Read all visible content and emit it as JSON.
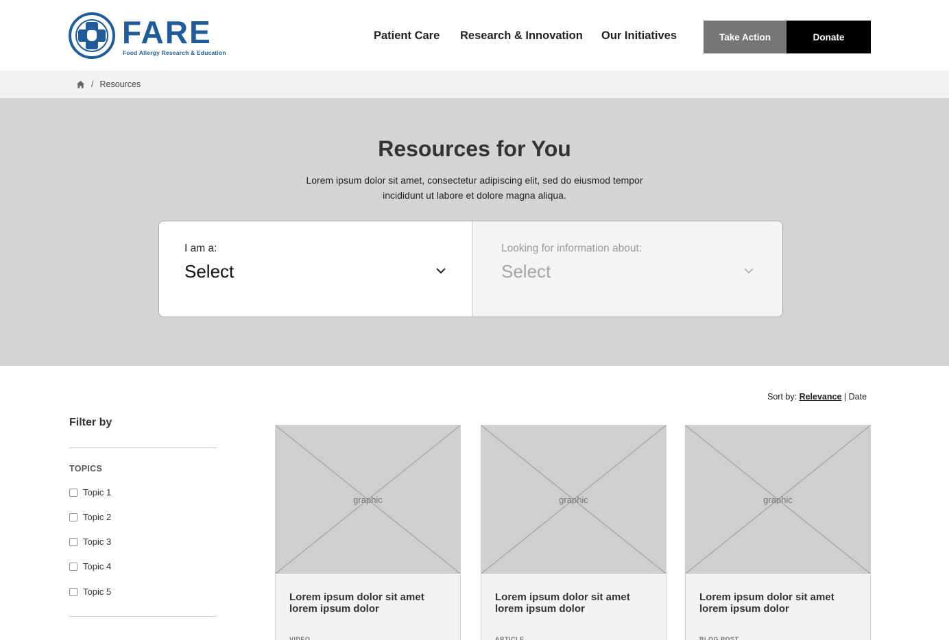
{
  "brand": {
    "logo_text": "FARE",
    "logo_subtitle": "Food Allergy Research & Education",
    "color": "#1f5c99"
  },
  "nav": {
    "items": [
      {
        "label": "Patient Care"
      },
      {
        "label": "Research & Innovation"
      },
      {
        "label": "Our Initiatives"
      }
    ],
    "take_action_label": "Take Action",
    "donate_label": "Donate"
  },
  "breadcrumb": {
    "home_icon": "home-icon",
    "separator": "/",
    "current": "Resources"
  },
  "hero": {
    "title": "Resources for You",
    "description": "Lorem ipsum dolor sit amet, consectetur adipiscing elit, sed do eiusmod tempor incididunt ut labore et dolore magna aliqua."
  },
  "selector": {
    "left": {
      "label": "I am a:",
      "value": "Select",
      "icon": "chevron-down-icon"
    },
    "right": {
      "label": "Looking for information about:",
      "value": "Select",
      "icon": "chevron-down-icon"
    }
  },
  "sort": {
    "label": "Sort by:",
    "options": [
      "Relevance",
      "Date"
    ],
    "active": "Relevance",
    "separator": "|"
  },
  "filter": {
    "title": "Filter by",
    "section_title": "TOPICS",
    "topics": [
      "Topic 1",
      "Topic 2",
      "Topic 3",
      "Topic 4",
      "Topic 5"
    ]
  },
  "cards": [
    {
      "graphic_label": "graphic",
      "title": "Lorem ipsum dolor sit amet lorem ipsum dolor",
      "type": "VIDEO"
    },
    {
      "graphic_label": "graphic",
      "title": "Lorem ipsum dolor sit amet lorem ipsum dolor",
      "type": "ARTICLE"
    },
    {
      "graphic_label": "graphic",
      "title": "Lorem ipsum dolor sit amet lorem ipsum dolor",
      "type": "BLOG POST"
    }
  ]
}
